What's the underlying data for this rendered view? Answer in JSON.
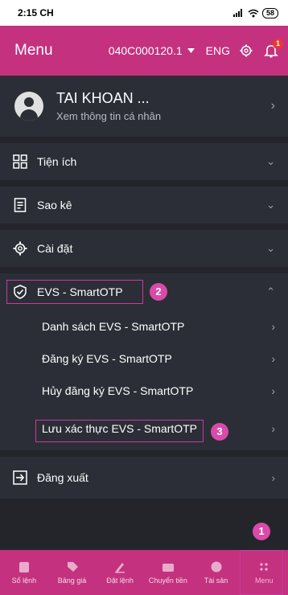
{
  "status": {
    "time": "2:15 CH",
    "battery": "58"
  },
  "header": {
    "title": "Menu",
    "account": "040C000120.1",
    "lang": "ENG",
    "notif_count": "1"
  },
  "profile": {
    "name": "TAI KHOAN ...",
    "subtitle": "Xem thông tin cá nhân"
  },
  "menu": {
    "utilities": "Tiện ích",
    "statements": "Sao kê",
    "settings": "Cài đặt",
    "evs": "EVS - SmartOTP",
    "evs_items": [
      "Danh sách EVS - SmartOTP",
      "Đăng ký EVS - SmartOTP",
      "Hủy đăng ký EVS - SmartOTP",
      "Lưu xác thực EVS - SmartOTP"
    ],
    "logout": "Đăng xuất"
  },
  "callouts": {
    "one": "1",
    "two": "2",
    "three": "3"
  },
  "tabs": [
    "Sổ lệnh",
    "Bảng giá",
    "Đặt lệnh",
    "Chuyển tiền",
    "Tài sản",
    "Menu"
  ],
  "colors": {
    "brand": "#c4317f",
    "highlight": "#c93b9d",
    "background": "#2b2e36"
  }
}
